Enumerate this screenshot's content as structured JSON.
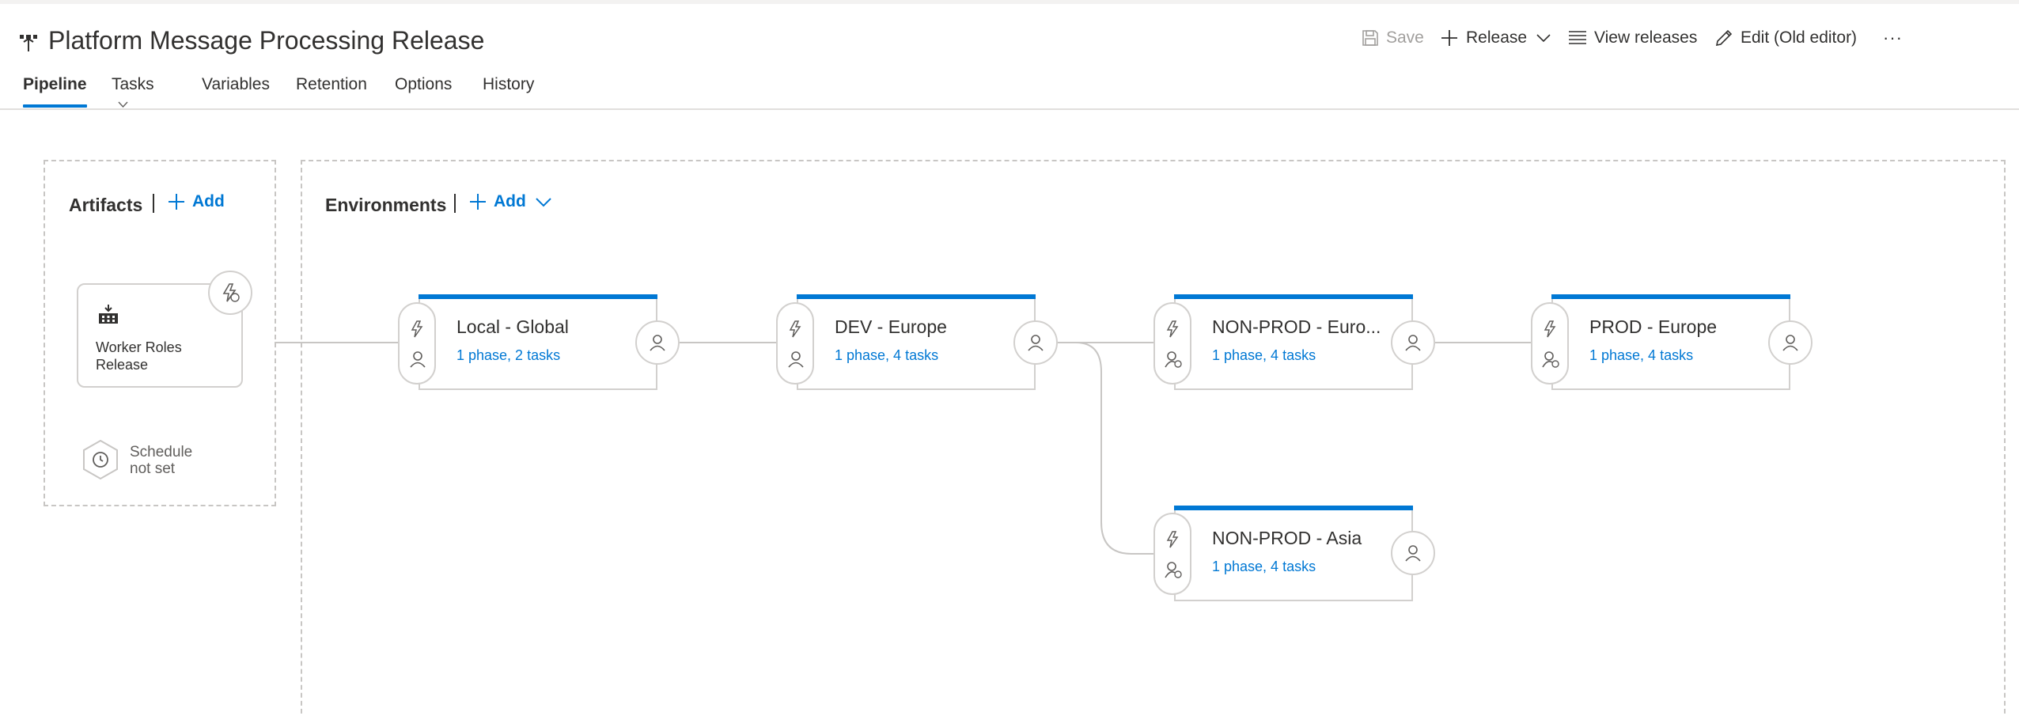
{
  "header": {
    "title": "Platform Message Processing Release",
    "commands": {
      "save": "Save",
      "release": "Release",
      "view_releases": "View releases",
      "edit_old": "Edit (Old editor)",
      "more": "···"
    }
  },
  "tabs": {
    "pipeline": "Pipeline",
    "tasks": "Tasks",
    "variables": "Variables",
    "retention": "Retention",
    "options": "Options",
    "history": "History"
  },
  "artifacts": {
    "title": "Artifacts",
    "add_label": "Add",
    "item": "Worker Roles Release",
    "schedule": "Schedule not set"
  },
  "environments": {
    "title": "Environments",
    "add_label": "Add",
    "items": [
      {
        "name": "Local - Global",
        "summary": "1 phase, 2 tasks"
      },
      {
        "name": "DEV - Europe",
        "summary": "1 phase, 4 tasks"
      },
      {
        "name": "NON-PROD - Euro...",
        "summary": "1 phase, 4 tasks"
      },
      {
        "name": "PROD - Europe",
        "summary": "1 phase, 4 tasks"
      },
      {
        "name": "NON-PROD - Asia",
        "summary": "1 phase, 4 tasks"
      }
    ]
  },
  "colors": {
    "accent": "#0078d4",
    "border": "#d2d0ce",
    "dashed": "#c8c6c4",
    "text": "#323130"
  }
}
